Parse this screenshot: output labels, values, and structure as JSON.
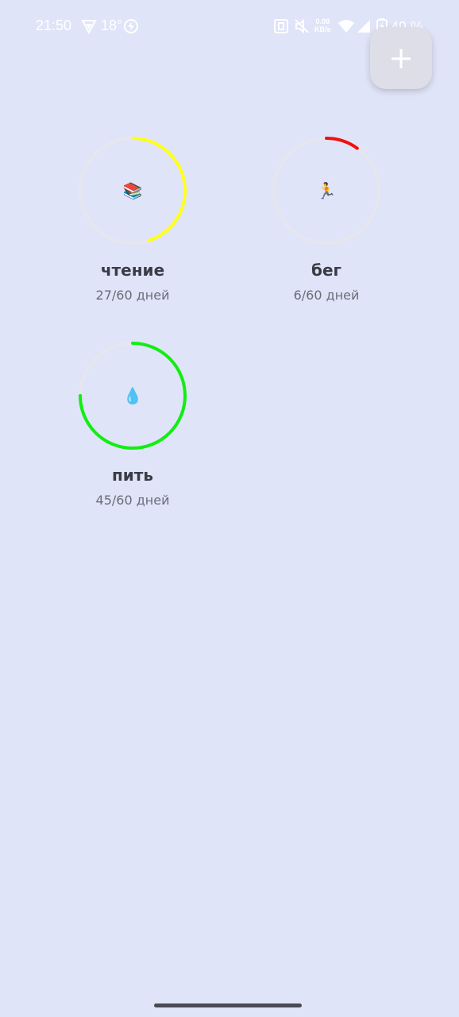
{
  "status_bar": {
    "time": "21:50",
    "temperature": "18°",
    "network_speed_value": "0.08",
    "network_speed_unit": "KB/s",
    "battery_percent": "49 %",
    "icons": [
      "vpn-icon",
      "charging-bolt-icon",
      "nfc-icon",
      "mute-icon",
      "wifi-icon",
      "signal-icon",
      "battery-icon"
    ]
  },
  "fab": {
    "label": "+"
  },
  "habits": [
    {
      "name": "чтение",
      "emoji": "📚",
      "progress_text": "27/60 дней",
      "done": 27,
      "total": 60,
      "color": "#ffff1a"
    },
    {
      "name": "бег",
      "emoji": "🏃",
      "progress_text": "6/60 дней",
      "done": 6,
      "total": 60,
      "color": "#ee1111"
    },
    {
      "name": "пить",
      "emoji": "💧",
      "progress_text": "45/60 дней",
      "done": 45,
      "total": 60,
      "color": "#11ee11"
    }
  ],
  "colors": {
    "background": "#e0e4f8",
    "ring_track": "#e6e6ee",
    "text_primary": "#3a3b45",
    "text_secondary": "#6b6c77"
  }
}
